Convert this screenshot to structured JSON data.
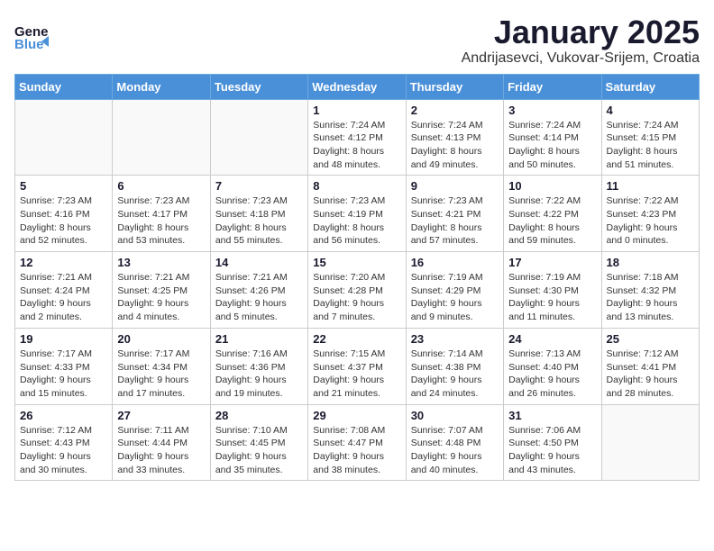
{
  "header": {
    "logo_general": "General",
    "logo_blue": "Blue",
    "month_title": "January 2025",
    "location": "Andrijasevci, Vukovar-Srijem, Croatia"
  },
  "days_of_week": [
    "Sunday",
    "Monday",
    "Tuesday",
    "Wednesday",
    "Thursday",
    "Friday",
    "Saturday"
  ],
  "weeks": [
    [
      {
        "day": "",
        "content": "",
        "empty": true
      },
      {
        "day": "",
        "content": "",
        "empty": true
      },
      {
        "day": "",
        "content": "",
        "empty": true
      },
      {
        "day": "1",
        "content": "Sunrise: 7:24 AM\nSunset: 4:12 PM\nDaylight: 8 hours\nand 48 minutes.",
        "empty": false
      },
      {
        "day": "2",
        "content": "Sunrise: 7:24 AM\nSunset: 4:13 PM\nDaylight: 8 hours\nand 49 minutes.",
        "empty": false
      },
      {
        "day": "3",
        "content": "Sunrise: 7:24 AM\nSunset: 4:14 PM\nDaylight: 8 hours\nand 50 minutes.",
        "empty": false
      },
      {
        "day": "4",
        "content": "Sunrise: 7:24 AM\nSunset: 4:15 PM\nDaylight: 8 hours\nand 51 minutes.",
        "empty": false
      }
    ],
    [
      {
        "day": "5",
        "content": "Sunrise: 7:23 AM\nSunset: 4:16 PM\nDaylight: 8 hours\nand 52 minutes.",
        "empty": false
      },
      {
        "day": "6",
        "content": "Sunrise: 7:23 AM\nSunset: 4:17 PM\nDaylight: 8 hours\nand 53 minutes.",
        "empty": false
      },
      {
        "day": "7",
        "content": "Sunrise: 7:23 AM\nSunset: 4:18 PM\nDaylight: 8 hours\nand 55 minutes.",
        "empty": false
      },
      {
        "day": "8",
        "content": "Sunrise: 7:23 AM\nSunset: 4:19 PM\nDaylight: 8 hours\nand 56 minutes.",
        "empty": false
      },
      {
        "day": "9",
        "content": "Sunrise: 7:23 AM\nSunset: 4:21 PM\nDaylight: 8 hours\nand 57 minutes.",
        "empty": false
      },
      {
        "day": "10",
        "content": "Sunrise: 7:22 AM\nSunset: 4:22 PM\nDaylight: 8 hours\nand 59 minutes.",
        "empty": false
      },
      {
        "day": "11",
        "content": "Sunrise: 7:22 AM\nSunset: 4:23 PM\nDaylight: 9 hours\nand 0 minutes.",
        "empty": false
      }
    ],
    [
      {
        "day": "12",
        "content": "Sunrise: 7:21 AM\nSunset: 4:24 PM\nDaylight: 9 hours\nand 2 minutes.",
        "empty": false
      },
      {
        "day": "13",
        "content": "Sunrise: 7:21 AM\nSunset: 4:25 PM\nDaylight: 9 hours\nand 4 minutes.",
        "empty": false
      },
      {
        "day": "14",
        "content": "Sunrise: 7:21 AM\nSunset: 4:26 PM\nDaylight: 9 hours\nand 5 minutes.",
        "empty": false
      },
      {
        "day": "15",
        "content": "Sunrise: 7:20 AM\nSunset: 4:28 PM\nDaylight: 9 hours\nand 7 minutes.",
        "empty": false
      },
      {
        "day": "16",
        "content": "Sunrise: 7:19 AM\nSunset: 4:29 PM\nDaylight: 9 hours\nand 9 minutes.",
        "empty": false
      },
      {
        "day": "17",
        "content": "Sunrise: 7:19 AM\nSunset: 4:30 PM\nDaylight: 9 hours\nand 11 minutes.",
        "empty": false
      },
      {
        "day": "18",
        "content": "Sunrise: 7:18 AM\nSunset: 4:32 PM\nDaylight: 9 hours\nand 13 minutes.",
        "empty": false
      }
    ],
    [
      {
        "day": "19",
        "content": "Sunrise: 7:17 AM\nSunset: 4:33 PM\nDaylight: 9 hours\nand 15 minutes.",
        "empty": false
      },
      {
        "day": "20",
        "content": "Sunrise: 7:17 AM\nSunset: 4:34 PM\nDaylight: 9 hours\nand 17 minutes.",
        "empty": false
      },
      {
        "day": "21",
        "content": "Sunrise: 7:16 AM\nSunset: 4:36 PM\nDaylight: 9 hours\nand 19 minutes.",
        "empty": false
      },
      {
        "day": "22",
        "content": "Sunrise: 7:15 AM\nSunset: 4:37 PM\nDaylight: 9 hours\nand 21 minutes.",
        "empty": false
      },
      {
        "day": "23",
        "content": "Sunrise: 7:14 AM\nSunset: 4:38 PM\nDaylight: 9 hours\nand 24 minutes.",
        "empty": false
      },
      {
        "day": "24",
        "content": "Sunrise: 7:13 AM\nSunset: 4:40 PM\nDaylight: 9 hours\nand 26 minutes.",
        "empty": false
      },
      {
        "day": "25",
        "content": "Sunrise: 7:12 AM\nSunset: 4:41 PM\nDaylight: 9 hours\nand 28 minutes.",
        "empty": false
      }
    ],
    [
      {
        "day": "26",
        "content": "Sunrise: 7:12 AM\nSunset: 4:43 PM\nDaylight: 9 hours\nand 30 minutes.",
        "empty": false
      },
      {
        "day": "27",
        "content": "Sunrise: 7:11 AM\nSunset: 4:44 PM\nDaylight: 9 hours\nand 33 minutes.",
        "empty": false
      },
      {
        "day": "28",
        "content": "Sunrise: 7:10 AM\nSunset: 4:45 PM\nDaylight: 9 hours\nand 35 minutes.",
        "empty": false
      },
      {
        "day": "29",
        "content": "Sunrise: 7:08 AM\nSunset: 4:47 PM\nDaylight: 9 hours\nand 38 minutes.",
        "empty": false
      },
      {
        "day": "30",
        "content": "Sunrise: 7:07 AM\nSunset: 4:48 PM\nDaylight: 9 hours\nand 40 minutes.",
        "empty": false
      },
      {
        "day": "31",
        "content": "Sunrise: 7:06 AM\nSunset: 4:50 PM\nDaylight: 9 hours\nand 43 minutes.",
        "empty": false
      },
      {
        "day": "",
        "content": "",
        "empty": true
      }
    ]
  ]
}
